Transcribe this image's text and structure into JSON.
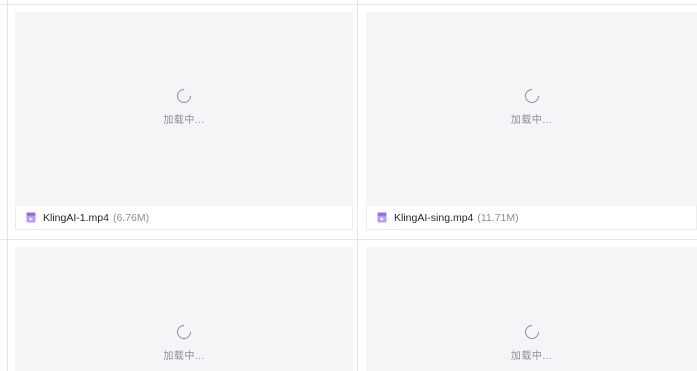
{
  "files": [
    {
      "name": "KlingAI-1.mp4",
      "size": "(6.76M)",
      "loading_text": "加载中...",
      "icon": "video-file-icon"
    },
    {
      "name": "KlingAI-sing.mp4",
      "size": "(11.71M)",
      "loading_text": "加载中...",
      "icon": "video-file-icon"
    },
    {
      "loading_text": "加载中..."
    },
    {
      "loading_text": "加载中..."
    }
  ],
  "colors": {
    "preview_bg": "#f4f5f7",
    "icon_accent": "#8f6bf0",
    "muted_text": "#8a8e99"
  }
}
